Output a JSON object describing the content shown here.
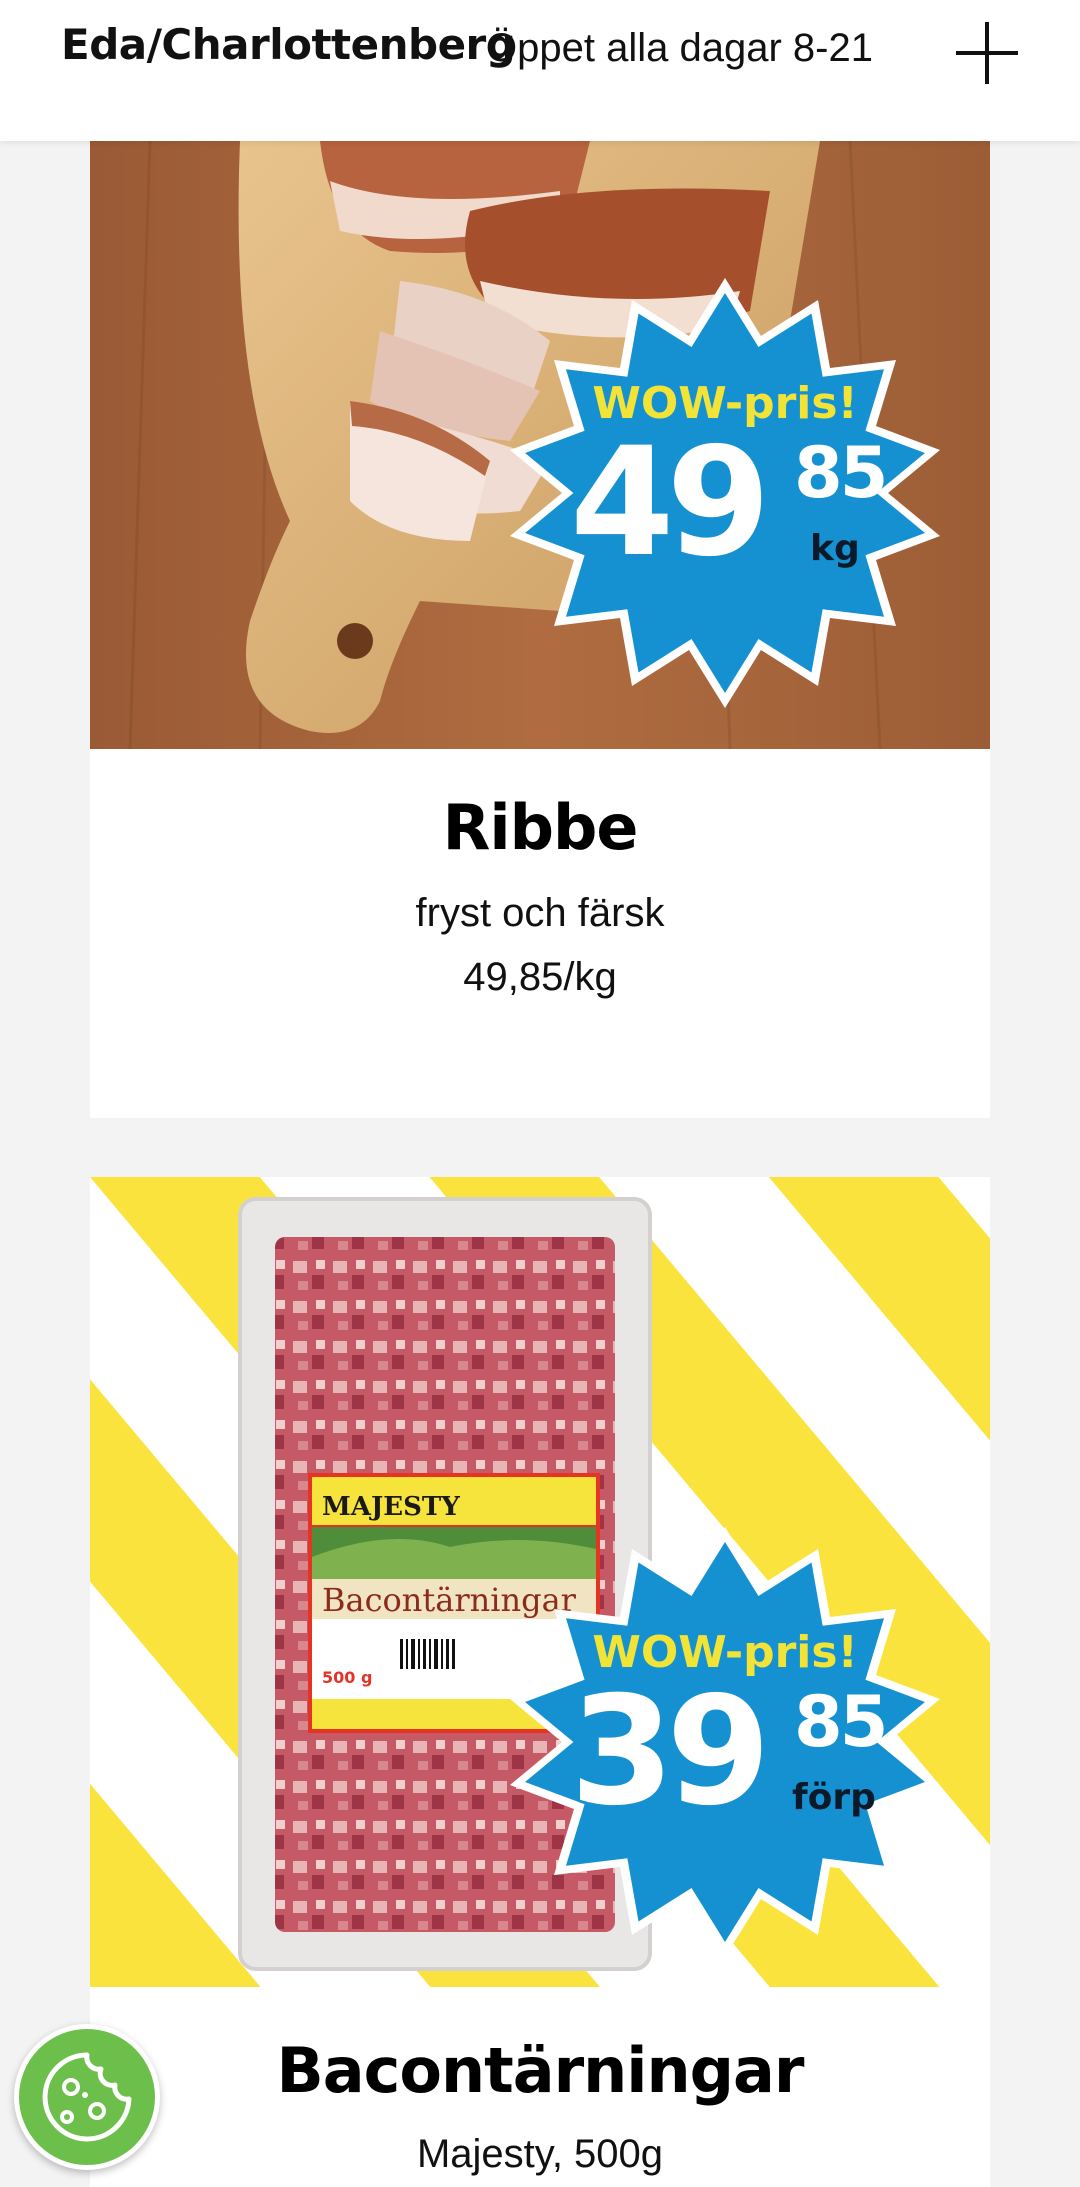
{
  "header": {
    "store_name": "Eda/Charlottenberg",
    "hours": "Öppet alla dagar 8-21",
    "plus_icon": "plus-icon"
  },
  "products": [
    {
      "title": "Ribbe",
      "subtitle": "fryst och färsk",
      "price_line": "49,85/kg",
      "badge": {
        "label": "WOW-pris!",
        "whole": "49",
        "cents": "85",
        "unit": "kg"
      },
      "image": "roast-pork-on-cutting-board"
    },
    {
      "title": "Bacontärningar",
      "subtitle": "Majesty, 500g",
      "badge": {
        "label": "WOW-pris!",
        "whole": "39",
        "cents": "85",
        "unit": "förp"
      },
      "package": {
        "brand": "MAJESTY",
        "name": "Bacontärningar",
        "weight": "500 g"
      },
      "image": "bacon-cubes-package"
    }
  ],
  "colors": {
    "badge_blue": "#1591d1",
    "badge_yellow": "#f2e337",
    "stripe_yellow": "#fbe33e",
    "cookie_green": "#6dbf4b",
    "header_bg": "#ffffff",
    "page_bg": "#f3f3f3"
  },
  "cookie_button": {
    "icon": "cookie-icon"
  }
}
